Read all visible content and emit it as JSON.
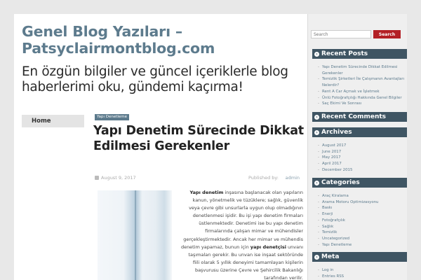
{
  "site": {
    "title": "Genel Blog Yazıları – Patsyclairmontblog.com",
    "description": "En özgün bilgiler ve güncel içeriklerle blog haberlerimi oku, gündemi kaçırma!"
  },
  "nav": {
    "home_label": "Home"
  },
  "post": {
    "category": "Yapı Denetleme",
    "title": "Yapı Denetim Sürecinde Dikkat Edilmesi Gerekenler",
    "date": "August 9, 2017",
    "published_by_label": "Published by:",
    "author": "admin",
    "body_segments": [
      {
        "text": "Yapı denetim",
        "bold": true
      },
      {
        "text": " inşasına başlanacak olan yapıların kanun, yönetmelik ve tüzüklere; sağlık, güvenlik veya çevre gibi unsurlarla uygun olup olmadığının denetlenmesi işidir. Bu işi yapı denetim firmaları üstlenmektedir. Denetimi ise bu yapı denetim firmalarında çalışan mimar ve mühendisler gerçekleştirmektedir. Ancak her mimar ve mühendis denetim yapamaz, bunun için ",
        "bold": false
      },
      {
        "text": "yapı denetçisi",
        "bold": true
      },
      {
        "text": " unvanı taşımaları gerekir. Bu unvan ise inşaat sektöründe fiili olarak 5 yıllık deneyimi tamamlayan kişilerin başvurusu üzerine Çevre ve Şehircilik Bakanlığı tarafından verilir.",
        "bold": false
      }
    ]
  },
  "sidebar": {
    "search": {
      "placeholder": "Search",
      "button": "Search"
    },
    "recent_posts": {
      "title": "Recent Posts",
      "items": [
        "Yapı Denetim Sürecinde Dikkat Edilmesi Gerekenler",
        "Temizlik Şirketleri İle Çalışmanın Avantajları Nelerdir?",
        "Rent A Car Açmak ve İşletmek",
        "Ünlü Fotoğrafçılığı Hakkında Genel Bilgiler",
        "Saç Ekimi Ve Sonrası"
      ]
    },
    "recent_comments": {
      "title": "Recent Comments"
    },
    "archives": {
      "title": "Archives",
      "items": [
        "August 2017",
        "June 2017",
        "May 2017",
        "April 2017",
        "December 2015"
      ]
    },
    "categories": {
      "title": "Categories",
      "items": [
        "Araç Kiralama",
        "Arama Motoru Optimizasyonu",
        "Baskı",
        "Enerji",
        "Fotoğrafçılık",
        "Sağlık",
        "Temizlik",
        "Uncategorized",
        "Yapı Denetleme"
      ]
    },
    "meta": {
      "title": "Meta",
      "items": [
        "Log in",
        "Entries RSS"
      ]
    }
  },
  "icon_names": {
    "widget": "circle-arrow-icon",
    "date": "calendar-icon"
  },
  "colors": {
    "accent": "#5d7b8d",
    "widget_header": "#3f5563",
    "search_button": "#b32025"
  }
}
